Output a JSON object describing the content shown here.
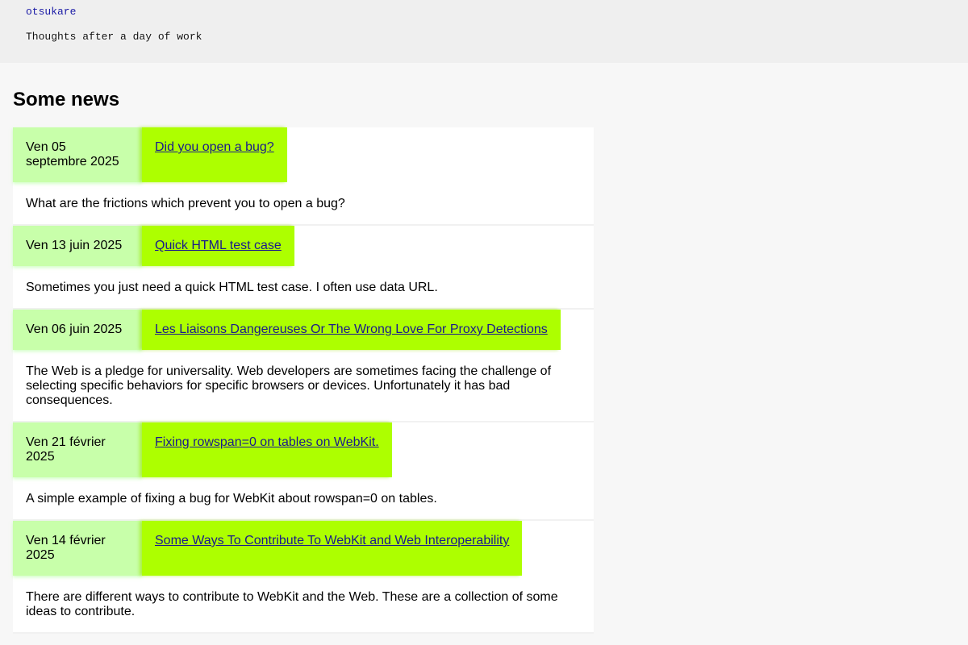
{
  "header": {
    "site_title": "otsukare",
    "tagline": "Thoughts after a day of work"
  },
  "main": {
    "heading": "Some news",
    "posts": [
      {
        "date": "Ven 05 septembre 2025",
        "title": "Did you open a bug?",
        "summary": "What are the frictions which prevent you to open a bug?"
      },
      {
        "date": "Ven 13 juin 2025",
        "title": "Quick HTML test case",
        "summary": "Sometimes you just need a quick HTML test case. I often use data URL."
      },
      {
        "date": "Ven 06 juin 2025",
        "title": "Les Liaisons Dangereuses Or The Wrong Love For Proxy Detections",
        "summary": "The Web is a pledge for universality. Web developers are sometimes facing the challenge of selecting specific behaviors for specific browsers or devices. Unfortunately it has bad consequences."
      },
      {
        "date": "Ven 21 février 2025",
        "title": "Fixing rowspan=0 on tables on WebKit.",
        "summary": "A simple example of fixing a bug for WebKit about rowspan=0 on tables."
      },
      {
        "date": "Ven 14 février 2025",
        "title": "Some Ways To Contribute To WebKit and Web Interoperability",
        "summary": "There are different ways to contribute to WebKit and the Web. These are a collection of some ideas to contribute."
      }
    ]
  }
}
